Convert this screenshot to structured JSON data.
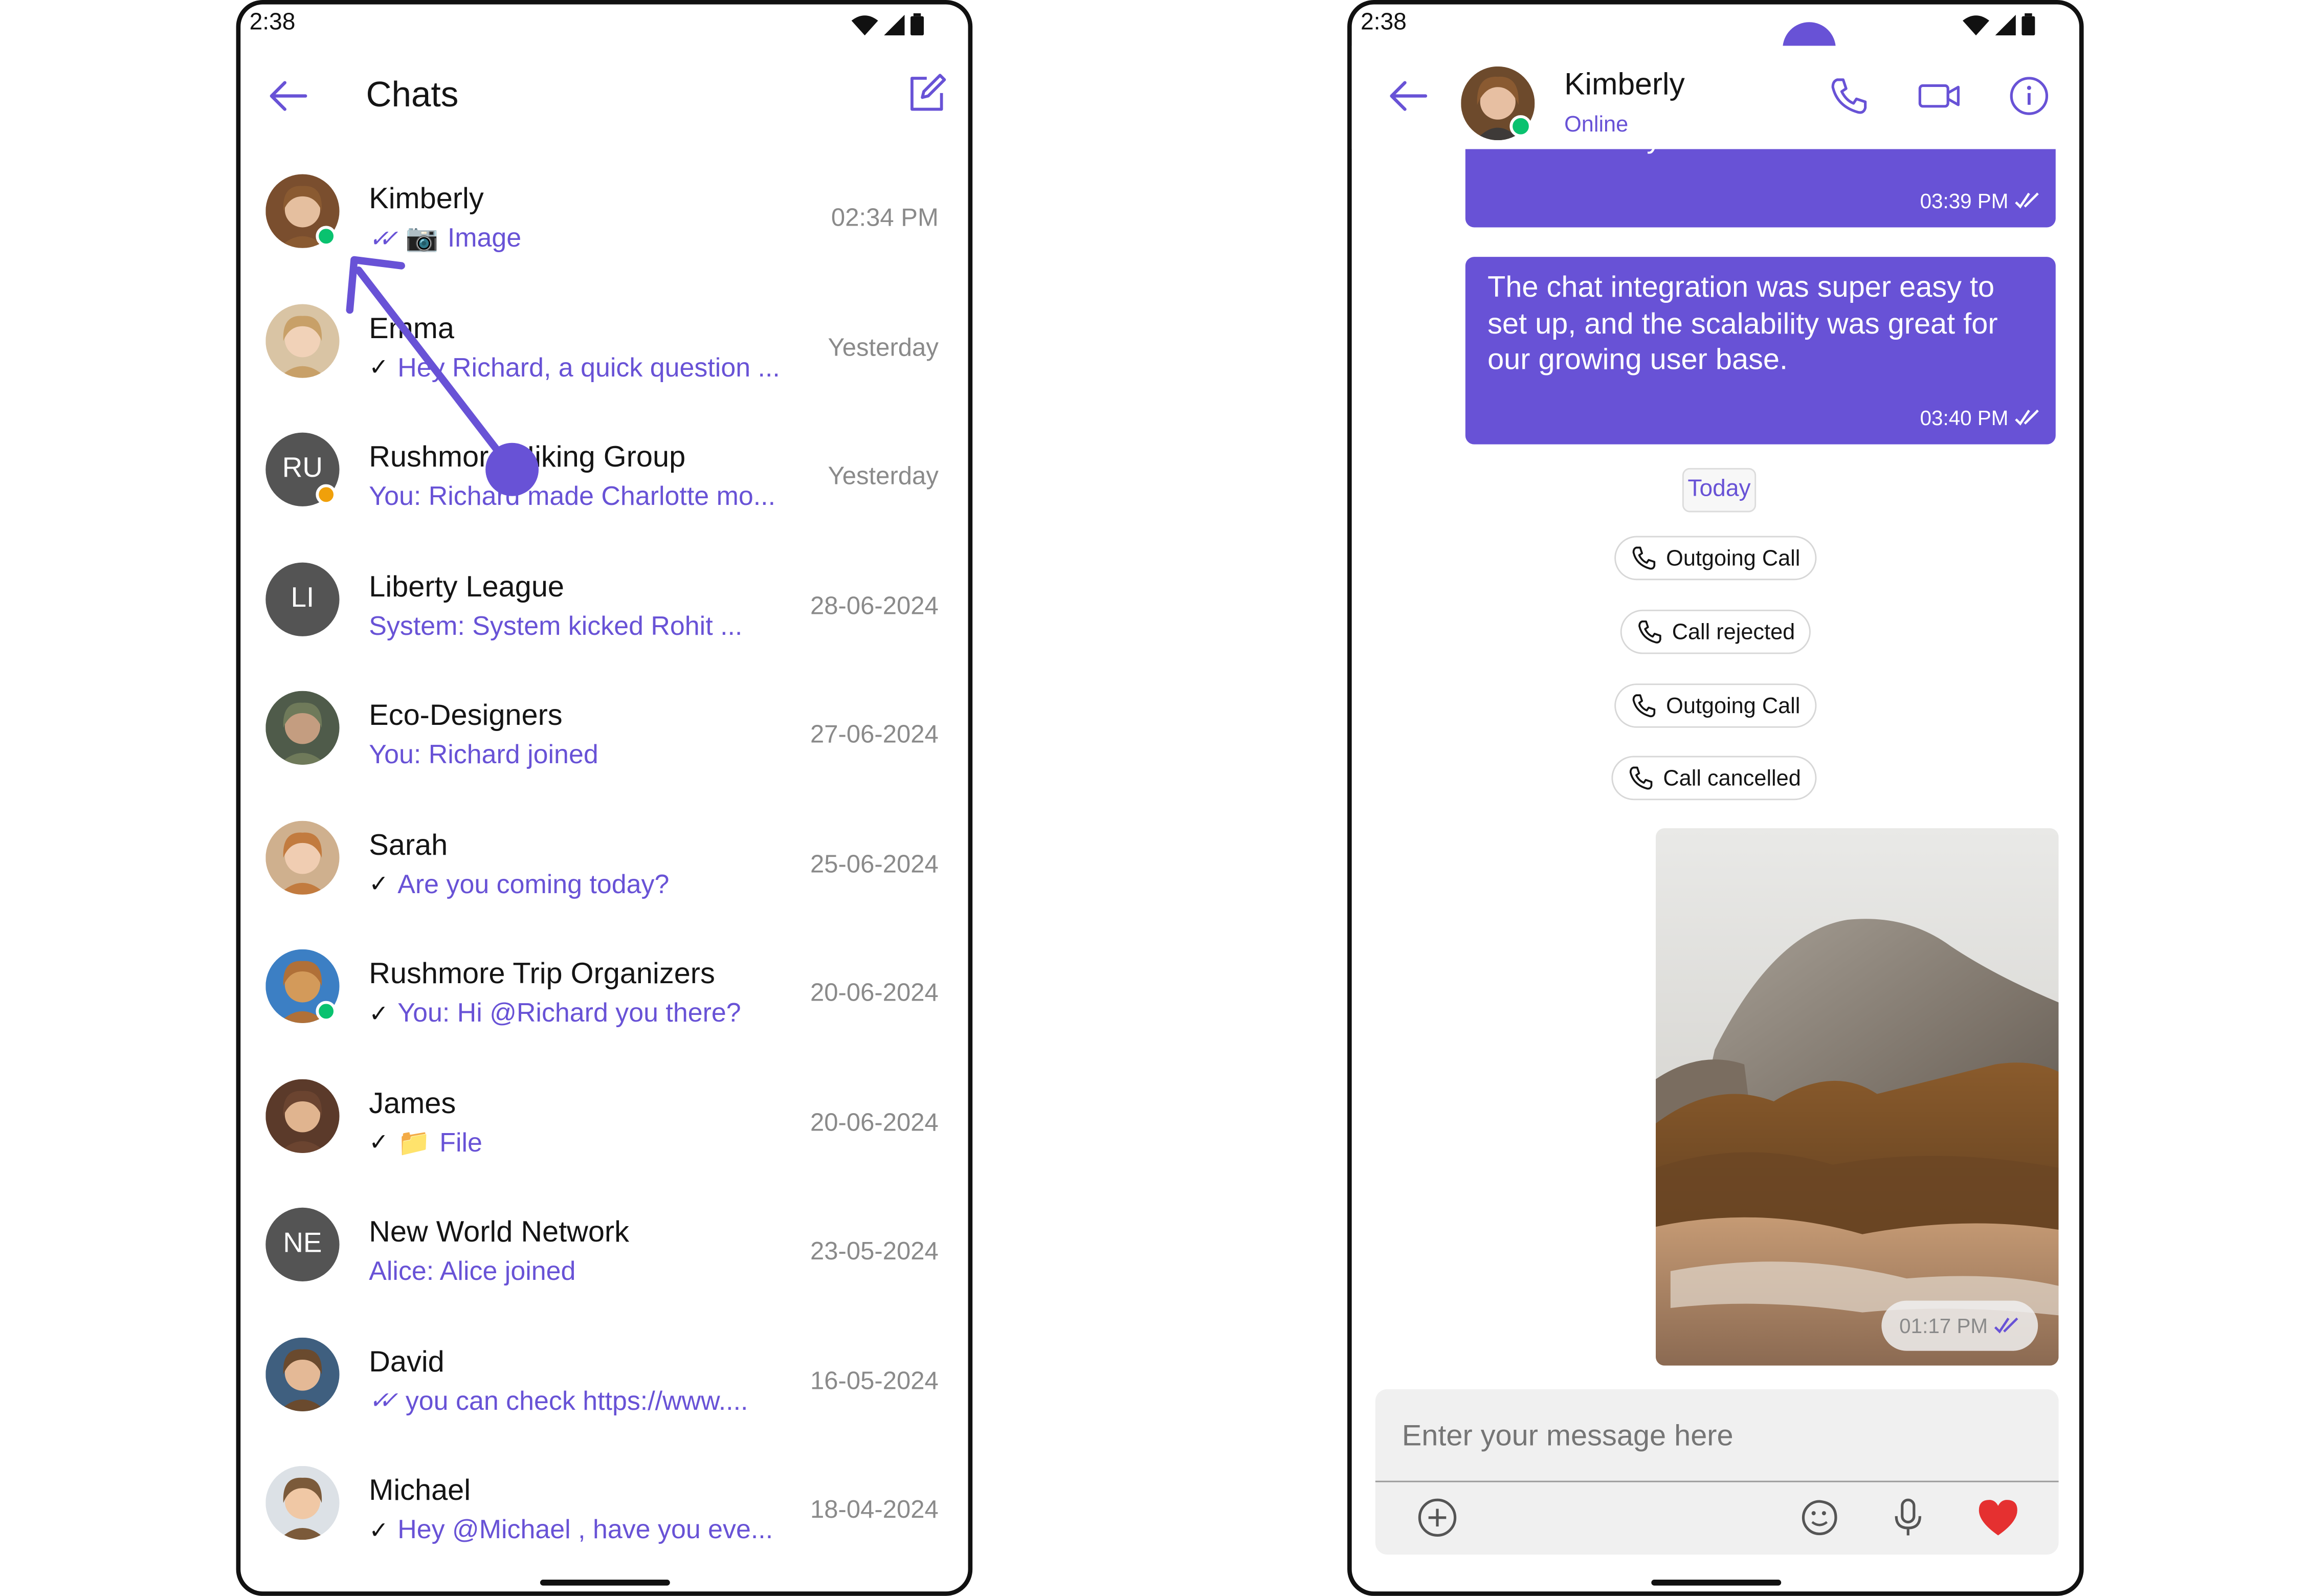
{
  "colors": {
    "accent": "#6852d6",
    "online": "#09c26f",
    "private": "#f0a00a",
    "ink": "#141414",
    "muted": "#8a8a8a"
  },
  "left_phone": {
    "status_time": "2:38",
    "header": {
      "title": "Chats",
      "back_icon": "arrow-left-icon",
      "compose_icon": "compose-icon"
    },
    "chats": [
      {
        "name": "Kimberly",
        "receipt": "read",
        "preview_icon": "📷",
        "preview": "Image",
        "time": "02:34 PM",
        "avatar": "photo",
        "status": "online"
      },
      {
        "name": "Emma",
        "receipt": "sent",
        "preview_icon": "",
        "preview": "Hey Richard, a quick question ...",
        "time": "Yesterday",
        "avatar": "photo",
        "status": ""
      },
      {
        "name": "Rushmore Hiking Group",
        "receipt": "",
        "preview_icon": "",
        "preview": "You: Richard made Charlotte mo...",
        "time": "Yesterday",
        "avatar": "RU",
        "status": "private"
      },
      {
        "name": "Liberty League",
        "receipt": "",
        "preview_icon": "",
        "preview": "System: System kicked Rohit ...",
        "time": "28-06-2024",
        "avatar": "LI",
        "status": ""
      },
      {
        "name": "Eco-Designers",
        "receipt": "",
        "preview_icon": "",
        "preview": "You: Richard joined",
        "time": "27-06-2024",
        "avatar": "photo",
        "status": ""
      },
      {
        "name": "Sarah",
        "receipt": "sent",
        "preview_icon": "",
        "preview": "Are you coming today?",
        "time": "25-06-2024",
        "avatar": "photo",
        "status": ""
      },
      {
        "name": "Rushmore Trip Organizers",
        "receipt": "sent",
        "preview_icon": "",
        "preview": "You: Hi @Richard you there?",
        "time": "20-06-2024",
        "avatar": "photo",
        "status": "password"
      },
      {
        "name": "James",
        "receipt": "sent",
        "preview_icon": "📁",
        "preview": "File",
        "time": "20-06-2024",
        "avatar": "photo",
        "status": ""
      },
      {
        "name": "New World Network",
        "receipt": "",
        "preview_icon": "",
        "preview": "Alice: Alice joined",
        "time": "23-05-2024",
        "avatar": "NE",
        "status": ""
      },
      {
        "name": "David",
        "receipt": "read",
        "preview_icon": "",
        "preview": "you can check https://www....",
        "time": "16-05-2024",
        "avatar": "photo",
        "status": ""
      },
      {
        "name": "Michael",
        "receipt": "sent",
        "preview_icon": "",
        "preview": "Hey @Michael , have you eve...",
        "time": "18-04-2024",
        "avatar": "photo",
        "status": ""
      }
    ]
  },
  "right_phone": {
    "status_time": "2:38",
    "header": {
      "name": "Kimberly",
      "status": "Online",
      "call_icon": "phone-icon",
      "video_icon": "video-icon",
      "info_icon": "info-icon"
    },
    "messages": [
      {
        "text": "worked really well.",
        "time": "03:39 PM"
      },
      {
        "text": "The chat integration was super easy to set up, and the scalability was great for our growing user base.",
        "time": "03:40 PM"
      }
    ],
    "date_separator": "Today",
    "calls": [
      "Outgoing Call",
      "Call rejected",
      "Outgoing Call",
      "Call cancelled"
    ],
    "image_message": {
      "time": "01:17 PM"
    },
    "composer": {
      "placeholder": "Enter your message here"
    }
  }
}
